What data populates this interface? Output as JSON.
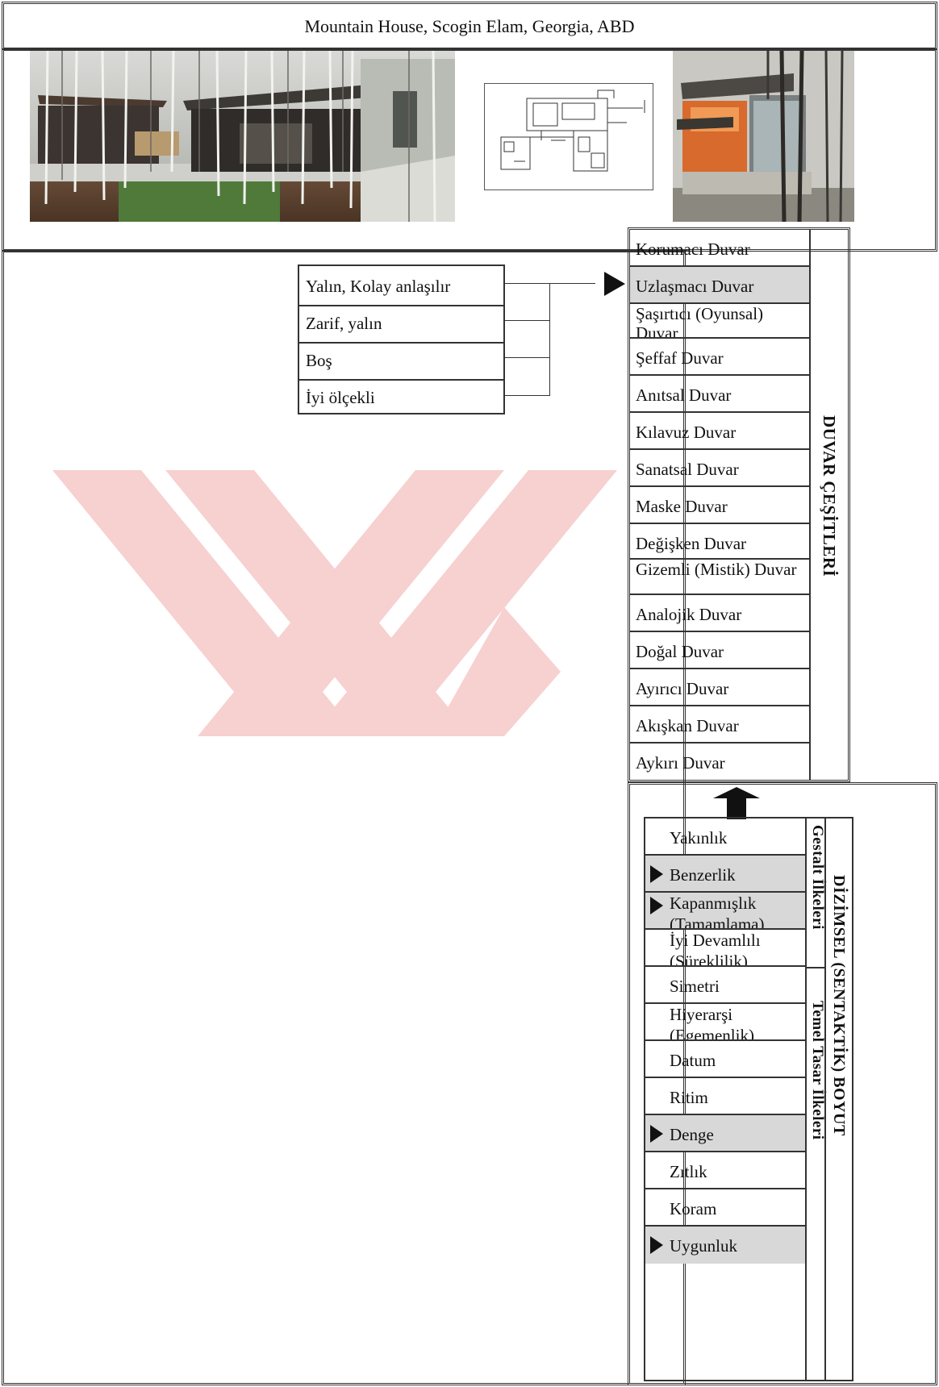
{
  "header": {
    "title": "Mountain House, Scogin Elam, Georgia, ABD"
  },
  "attributes": [
    "Yalın, Kolay anlaşılır",
    "Zarif, yalın",
    "Boş",
    "İyi ölçekli"
  ],
  "wall_types": {
    "title": "DUVAR ÇEŞİTLERİ",
    "items": [
      {
        "label": "Korumacı Duvar",
        "highlight": false
      },
      {
        "label": "Uzlaşmacı Duvar",
        "highlight": true
      },
      {
        "label": "Şaşırtıcı (Oyunsal) Duvar",
        "highlight": false
      },
      {
        "label": "Şeffaf Duvar",
        "highlight": false
      },
      {
        "label": "Anıtsal Duvar",
        "highlight": false
      },
      {
        "label": "Kılavuz Duvar",
        "highlight": false
      },
      {
        "label": "Sanatsal Duvar",
        "highlight": false
      },
      {
        "label": "Maske Duvar",
        "highlight": false
      },
      {
        "label": "Değişken Duvar",
        "highlight": false
      },
      {
        "label": "Gizemli (Mistik) Duvar",
        "highlight": false
      },
      {
        "label": "Analojik Duvar",
        "highlight": false
      },
      {
        "label": "Doğal Duvar",
        "highlight": false
      },
      {
        "label": "Ayırıcı Duvar",
        "highlight": false
      },
      {
        "label": "Akışkan Duvar",
        "highlight": false
      },
      {
        "label": "Aykırı Duvar",
        "highlight": false
      }
    ]
  },
  "syntactic": {
    "title": "DİZİMSEL (SENTAKTİK) BOYUT",
    "group1_title": "Gestalt İlkeleri",
    "group2_title": "Temel Tasar İlkeleri",
    "items": [
      {
        "label": "Yakınlık",
        "marked": false
      },
      {
        "label": "Benzerlik",
        "marked": true
      },
      {
        "label": "Kapanmışlık (Tamamlama)",
        "marked": true
      },
      {
        "label": "İyi Devamlılı (Süreklilik)",
        "marked": false
      },
      {
        "label": "Simetri",
        "marked": false
      },
      {
        "label": "Hiyerarşi (Egemenlik)",
        "marked": false
      },
      {
        "label": "Datum",
        "marked": false
      },
      {
        "label": "Ritim",
        "marked": false
      },
      {
        "label": "Denge",
        "marked": true
      },
      {
        "label": "Zıtlık",
        "marked": false
      },
      {
        "label": "Koram",
        "marked": false
      },
      {
        "label": "Uygunluk",
        "marked": true
      }
    ]
  }
}
